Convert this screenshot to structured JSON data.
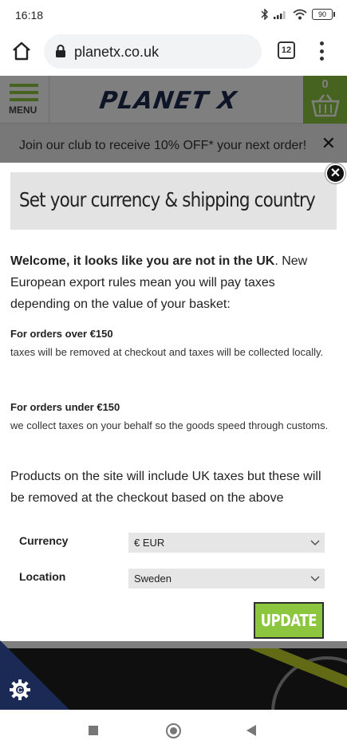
{
  "status_bar": {
    "time": "16:18",
    "battery": "90"
  },
  "browser": {
    "url": "planetx.co.uk",
    "tab_count": "12"
  },
  "site": {
    "menu_label": "MENU",
    "logo_text": "PLANET X",
    "basket_count": "0",
    "club_banner": "Join our club to receive 10% OFF* your next order!",
    "accent_color": "#8cc63f",
    "brand_navy": "#1d2a4e"
  },
  "modal": {
    "title": "Set your currency & shipping country",
    "intro_bold": "Welcome, it looks like you are not in the UK",
    "intro_rest": ". New European export rules mean you will pay taxes depending on the value of your basket:",
    "over_heading": "For orders over €150",
    "over_body": "taxes will be removed at checkout and taxes will be collected locally.",
    "under_heading": "For orders under €150",
    "under_body": "we collect taxes on your behalf so the goods speed through customs.",
    "products_note": "Products on the site will include UK taxes but these will be removed at the checkout based on the above",
    "currency_label": "Currency",
    "currency_value": "€ EUR",
    "location_label": "Location",
    "location_value": "Sweden",
    "update_label": "UPDATE"
  }
}
